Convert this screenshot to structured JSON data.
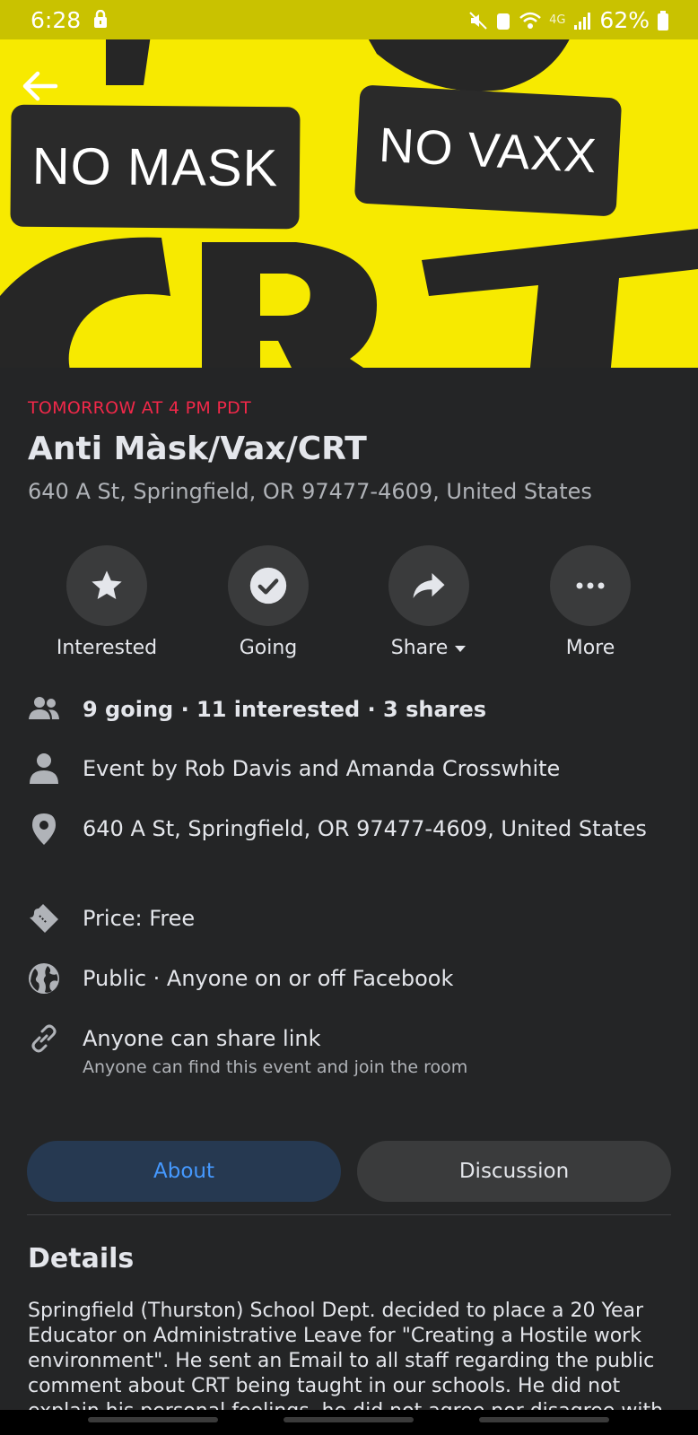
{
  "status_bar": {
    "time": "6:28",
    "battery": "62%",
    "network": "4G"
  },
  "cover": {
    "tag_left": "NO MASK",
    "tag_right": "NO VAXX"
  },
  "event": {
    "date": "TOMORROW AT 4 PM PDT",
    "title": "Anti Màsk/Vax/CRT",
    "address": "640 A St, Springfield, OR 97477-4609, United States"
  },
  "actions": [
    {
      "label": "Interested",
      "icon": "star-icon"
    },
    {
      "label": "Going",
      "icon": "check-circle-icon"
    },
    {
      "label": "Share",
      "icon": "share-arrow-icon"
    },
    {
      "label": "More",
      "icon": "more-dots-icon"
    }
  ],
  "info": {
    "stats": "9 going · 11 interested · 3 shares",
    "host": "Event by Rob Davis and Amanda Crosswhite",
    "location": "640 A St, Springfield, OR 97477-4609, United States",
    "price": "Price: Free",
    "privacy": "Public · Anyone on or off Facebook",
    "share_link": "Anyone can share link",
    "share_link_sub": "Anyone can find this event and join the room"
  },
  "tabs": {
    "about": "About",
    "discussion": "Discussion"
  },
  "details": {
    "heading": "Details",
    "body": "Springfield (Thurston) School Dept. decided to place a 20 Year Educator on Administrative Leave for \"Creating a Hostile work environment\". He sent an Email to all staff regarding the public comment about CRT being taught in our schools. He did not explain his personal feelings, he did not agree nor disagree with CRT. He"
  },
  "colors": {
    "background": "#242526",
    "accent_red": "#f02849",
    "accent_blue": "#4599ff",
    "cover_yellow": "#f7ea00"
  }
}
